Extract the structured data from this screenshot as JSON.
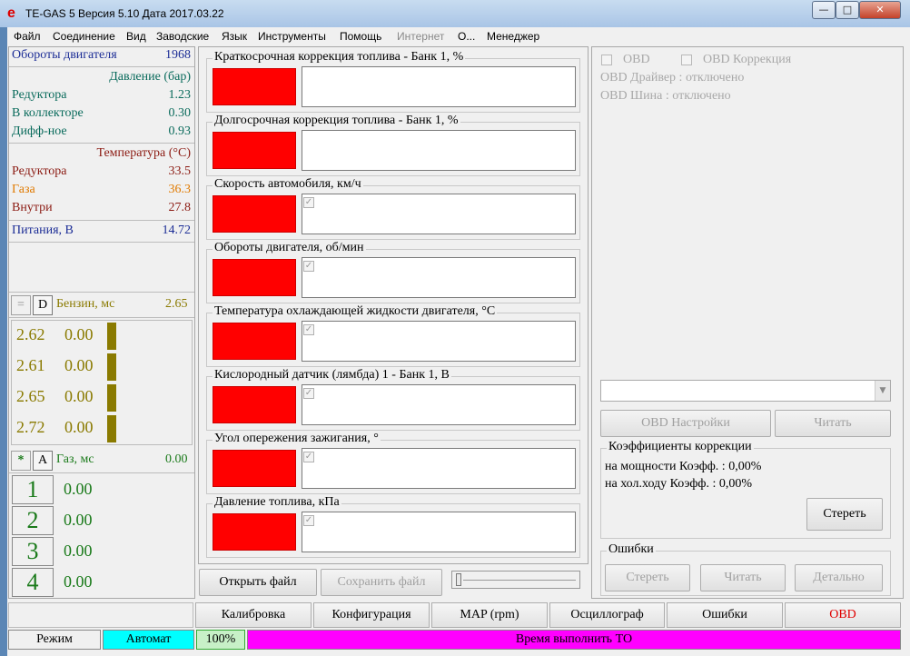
{
  "window": {
    "title": "TE-GAS 5  Версия 5.10  Дата 2017.03.22",
    "icon": "e-logo-icon",
    "controls": [
      "minimize-icon",
      "maximize-icon",
      "close-icon"
    ]
  },
  "menu": [
    "Файл",
    "Соединение",
    "Вид",
    "Заводские",
    "Язык",
    "Инструменты",
    "Помощь",
    "Интернет",
    "О...",
    "Менеджер"
  ],
  "left_panel": {
    "rpm_label": "Обороты двигателя",
    "rpm_value": "1968",
    "pressure_header": "Давление (бар)",
    "pressure": [
      {
        "label": "Редуктора",
        "value": "1.23"
      },
      {
        "label": "В коллекторе",
        "value": "0.30"
      },
      {
        "label": "Дифф-ное",
        "value": "0.93"
      }
    ],
    "temp_header": "Температура (°C)",
    "temps": [
      {
        "label": "Редуктора",
        "value": "33.5"
      },
      {
        "label": "Газа",
        "value": "36.3"
      },
      {
        "label": "Внутри",
        "value": "27.8"
      }
    ],
    "power_label": "Питания, В",
    "power_value": "14.72",
    "petrol_btn_eq": "=",
    "petrol_btn_d": "D",
    "petrol_label": "Бензин, мс",
    "petrol_value": "2.65",
    "petrol_rows": [
      {
        "a": "2.62",
        "b": "0.00"
      },
      {
        "a": "2.61",
        "b": "0.00"
      },
      {
        "a": "2.65",
        "b": "0.00"
      },
      {
        "a": "2.72",
        "b": "0.00"
      }
    ],
    "gas_btn_star": "*",
    "gas_btn_a": "A",
    "gas_label": "Газ, мс",
    "gas_value": "0.00",
    "cylinders": [
      {
        "n": "1",
        "v": "0.00"
      },
      {
        "n": "2",
        "v": "0.00"
      },
      {
        "n": "3",
        "v": "0.00"
      },
      {
        "n": "4",
        "v": "0.00"
      }
    ]
  },
  "gauges": [
    {
      "title": "Краткосрочная коррекция топлива - Банк 1, %",
      "checkbox": false
    },
    {
      "title": "Долгосрочная коррекция топлива - Банк 1, %",
      "checkbox": false
    },
    {
      "title": "Скорость автомобиля, км/ч",
      "checkbox": true
    },
    {
      "title": "Обороты двигателя, об/мин",
      "checkbox": true
    },
    {
      "title": "Температура охлаждающей жидкости двигателя, °C",
      "checkbox": true
    },
    {
      "title": "Кислородный датчик (лямбда) 1 - Банк 1, В",
      "checkbox": true
    },
    {
      "title": "Угол опережения зажигания, °",
      "checkbox": true
    },
    {
      "title": "Давление топлива, кПа",
      "checkbox": true
    }
  ],
  "file_buttons": {
    "open": "Открыть файл",
    "save": "Сохранить файл"
  },
  "obd": {
    "obd_chk": "OBD",
    "corr_chk": "OBD Коррекция",
    "driver": "OBD Драйвер : отключено",
    "bus": "OBD Шина : отключено",
    "settings_btn": "OBD Настройки",
    "read_btn": "Читать",
    "coef_title": "Коэффициенты коррекции",
    "coef_power": "на мощности Коэфф. : 0,00%",
    "coef_idle": "на хол.ходу Коэфф. : 0,00%",
    "erase_btn": "Стереть",
    "errors_title": "Ошибки",
    "err_erase": "Стереть",
    "err_read": "Читать",
    "err_detail": "Детально"
  },
  "tabs": [
    "Калибровка",
    "Конфигурация",
    "MAP (rpm)",
    "Осциллограф",
    "Ошибки",
    "OBD"
  ],
  "status": {
    "mode": "Режим",
    "auto": "Автомат",
    "percent": "100%",
    "message": "Время выполнить ТО"
  },
  "colors": {
    "red": "#ff0000",
    "olive": "#8a7a00",
    "green": "#1a7a1a",
    "cyan": "#00ffff",
    "magenta": "#ff00ff"
  }
}
